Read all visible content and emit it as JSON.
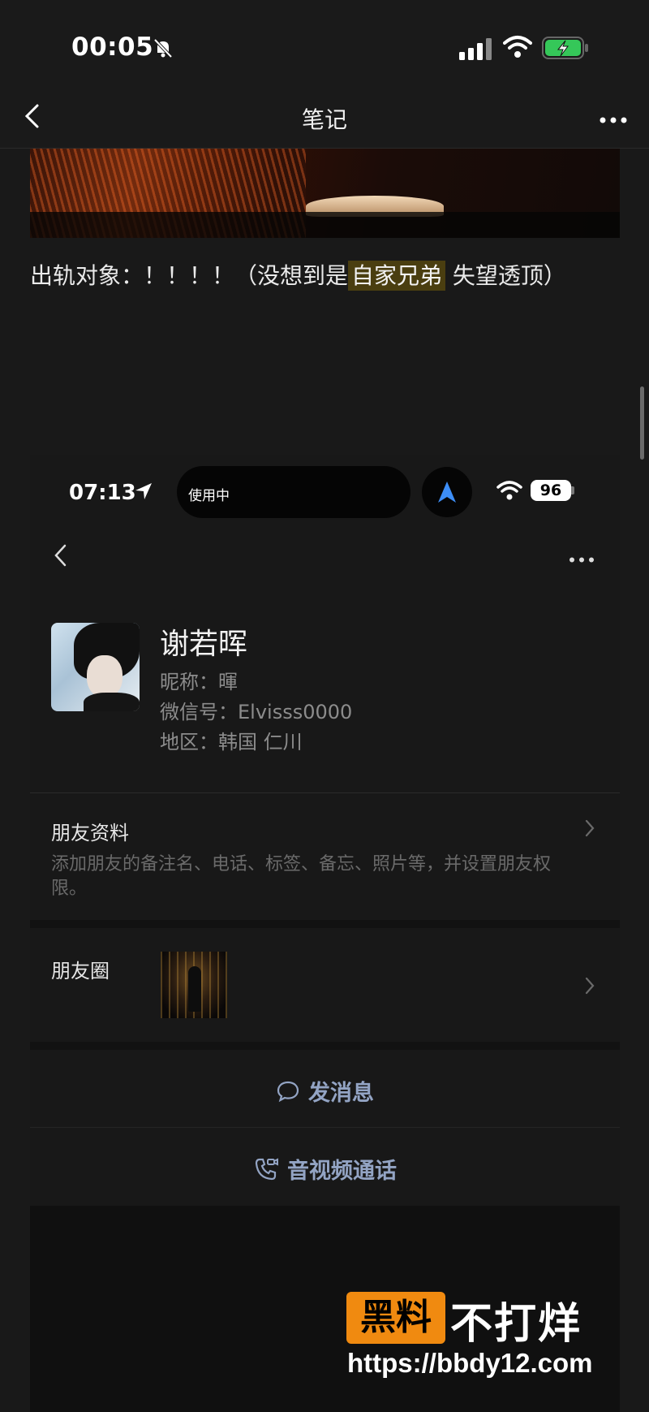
{
  "status_bar": {
    "time": "00:05"
  },
  "nav": {
    "title": "笔记"
  },
  "note": {
    "caption_pre": "出轨对象：！！！！（没想到是",
    "caption_highlight": "自家兄弟",
    "caption_post": " 失望透顶）"
  },
  "embedded": {
    "status_time": "07:13",
    "pill_text": "使用中",
    "battery": "96",
    "profile": {
      "name": "谢若晖",
      "nickname": "昵称：暉",
      "wechat_id": "微信号：Elvisss0000",
      "region": "地区：韩国 仁川"
    },
    "friend_info": {
      "title": "朋友资料",
      "desc": "添加朋友的备注名、电话、标签、备忘、照片等，并设置朋友权限。"
    },
    "moments": {
      "title": "朋友圈"
    },
    "actions": {
      "message": "发消息",
      "call": "音视频通话"
    }
  },
  "watermark": {
    "brand_box": "黑料",
    "brand_text": "不打烊",
    "url": "https://bbdy12.com"
  },
  "colors": {
    "background": "#191919",
    "highlight": "#4a3e10",
    "action": "#93a4c4",
    "watermark": "#f08a10"
  }
}
